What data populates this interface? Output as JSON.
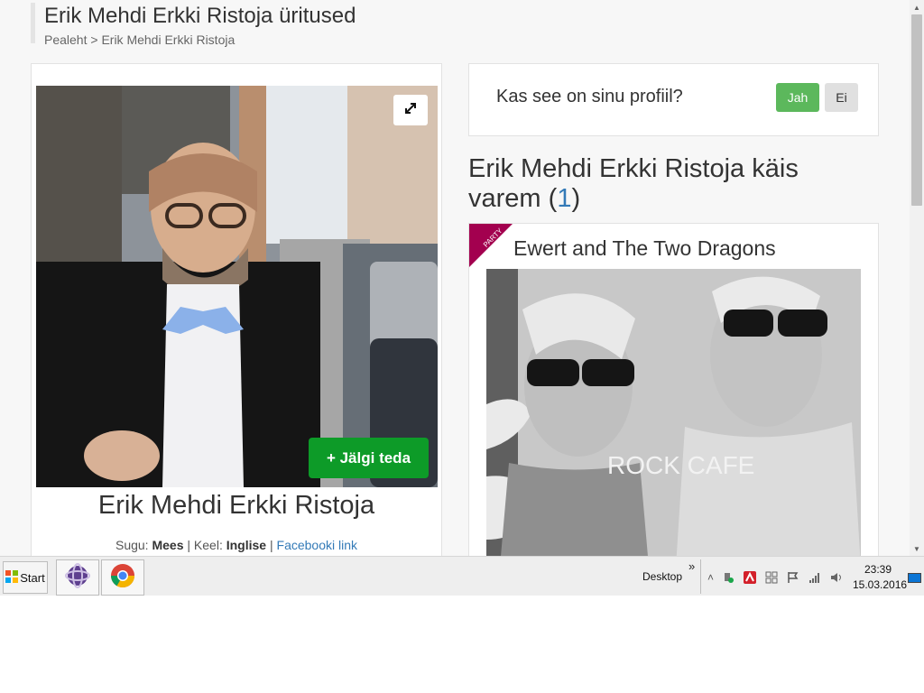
{
  "page": {
    "title": "Erik Mehdi Erkki Ristoja üritused",
    "breadcrumb": "Pealeht > Erik Mehdi Erkki Ristoja"
  },
  "person": {
    "name": "Erik Mehdi Erkki Ristoja",
    "follow_label": "+ Jälgi teda",
    "gender_label": "Sugu:",
    "gender": "Mees",
    "separator": "|",
    "language_label": "Keel:",
    "language": "Inglise",
    "facebook_link": "Facebooki link"
  },
  "profile_prompt": {
    "question": "Kas see on sinu profiil?",
    "yes": "Jah",
    "no": "Ei"
  },
  "past_events": {
    "heading": "Erik Mehdi Erkki Ristoja käis varem",
    "open_paren": "(",
    "count": "1",
    "close_paren": ")"
  },
  "event": {
    "category": "PARTY",
    "title": "Ewert and The Two Dragons",
    "image_text": "ROCK CAFE"
  },
  "taskbar": {
    "start": "Start",
    "desktop": "Desktop",
    "desktop_chevron": "»",
    "time": "23:39",
    "date": "15.03.2016"
  },
  "colors": {
    "accent_link": "#337ab7",
    "follow_button": "#0d9b28",
    "yes_button": "#5cb85c",
    "ribbon": "#a3004f"
  }
}
